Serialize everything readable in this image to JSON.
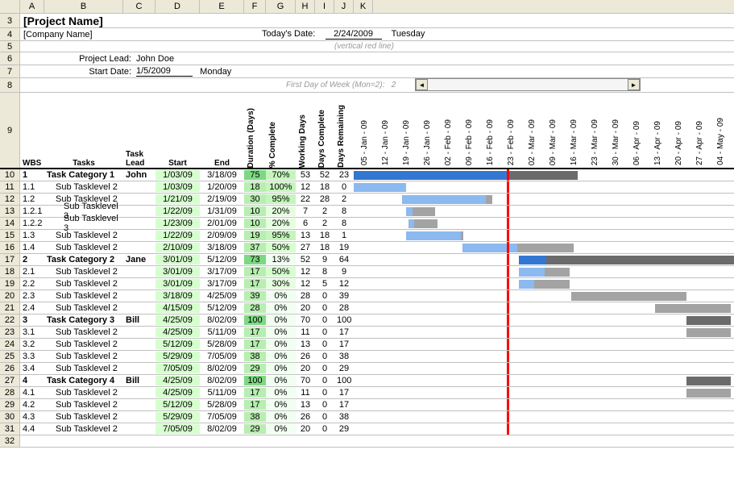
{
  "col_letters": [
    "A",
    "B",
    "C",
    "D",
    "E",
    "F",
    "G",
    "H",
    "I",
    "J",
    "K"
  ],
  "header": {
    "project_name": "[Project Name]",
    "company_name": "[Company Name]",
    "todays_date_label": "Today's Date:",
    "todays_date": "2/24/2009",
    "todays_day": "Tuesday",
    "vertical_note": "(vertical red line)",
    "project_lead_label": "Project Lead:",
    "project_lead": "John Doe",
    "start_date_label": "Start Date:",
    "start_date": "1/5/2009",
    "start_day": "Monday",
    "first_day_label": "First Day of Week (Mon=2):",
    "first_day_value": "2"
  },
  "columns": {
    "wbs": "WBS",
    "tasks": "Tasks",
    "lead": "Task Lead",
    "start": "Start",
    "end": "End",
    "dur": "Duration (Days)",
    "pct": "% Complete",
    "wd": "Working Days",
    "dc": "Days Complete",
    "dr": "Days Remaining"
  },
  "weeks": [
    "05 - Jan - 09",
    "12 - Jan - 09",
    "19 - Jan - 09",
    "26 - Jan - 09",
    "02 - Feb - 09",
    "09 - Feb - 09",
    "16 - Feb - 09",
    "23 - Feb - 09",
    "02 - Mar - 09",
    "09 - Mar - 09",
    "16 - Mar - 09",
    "23 - Mar - 09",
    "30 - Mar - 09",
    "06 - Apr - 09",
    "13 - Apr - 09",
    "20 - Apr - 09",
    "27 - Apr - 09",
    "04 - May - 09"
  ],
  "today_week_offset": 7.3,
  "rows": [
    {
      "n": 10,
      "wbs": "1",
      "task": "Task Category 1",
      "lead": "John",
      "start": "1/03/09",
      "end": "3/18/09",
      "dur": "75",
      "pct": "70%",
      "wd": "53",
      "dc": "52",
      "dr": "23",
      "cat": true,
      "bar": {
        "s": 0,
        "w": 7.3,
        "c": "blue-dark"
      },
      "bar2": {
        "s": 7.3,
        "w": 3.4,
        "c": "gray-dark"
      }
    },
    {
      "n": 11,
      "wbs": "1.1",
      "task": "Sub Tasklevel 2",
      "lead": "",
      "start": "1/03/09",
      "end": "1/20/09",
      "dur": "18",
      "pct": "100%",
      "wd": "12",
      "dc": "18",
      "dr": "0",
      "sub": 1,
      "bar": {
        "s": 0,
        "w": 2.5,
        "c": "blue-light"
      }
    },
    {
      "n": 12,
      "wbs": "1.2",
      "task": "Sub Tasklevel 2",
      "lead": "",
      "start": "1/21/09",
      "end": "2/19/09",
      "dur": "30",
      "pct": "95%",
      "wd": "22",
      "dc": "28",
      "dr": "2",
      "sub": 1,
      "bar": {
        "s": 2.3,
        "w": 4.0,
        "c": "blue-light"
      },
      "bar2": {
        "s": 6.3,
        "w": 0.3,
        "c": "gray-light"
      }
    },
    {
      "n": 13,
      "wbs": "1.2.1",
      "task": "Sub Tasklevel 3",
      "lead": "",
      "start": "1/22/09",
      "end": "1/31/09",
      "dur": "10",
      "pct": "20%",
      "wd": "7",
      "dc": "2",
      "dr": "8",
      "sub": 2,
      "bar": {
        "s": 2.5,
        "w": 0.3,
        "c": "blue-light"
      },
      "bar2": {
        "s": 2.8,
        "w": 1.1,
        "c": "gray-light"
      }
    },
    {
      "n": 14,
      "wbs": "1.2.2",
      "task": "Sub Tasklevel 3",
      "lead": "",
      "start": "1/23/09",
      "end": "2/01/09",
      "dur": "10",
      "pct": "20%",
      "wd": "6",
      "dc": "2",
      "dr": "8",
      "sub": 2,
      "bar": {
        "s": 2.6,
        "w": 0.3,
        "c": "blue-light"
      },
      "bar2": {
        "s": 2.9,
        "w": 1.1,
        "c": "gray-light"
      }
    },
    {
      "n": 15,
      "wbs": "1.3",
      "task": "Sub Tasklevel 2",
      "lead": "",
      "start": "1/22/09",
      "end": "2/09/09",
      "dur": "19",
      "pct": "95%",
      "wd": "13",
      "dc": "18",
      "dr": "1",
      "sub": 1,
      "bar": {
        "s": 2.5,
        "w": 2.6,
        "c": "blue-light"
      },
      "bar2": {
        "s": 5.1,
        "w": 0.15,
        "c": "gray-light"
      }
    },
    {
      "n": 16,
      "wbs": "1.4",
      "task": "Sub Tasklevel 2",
      "lead": "",
      "start": "2/10/09",
      "end": "3/18/09",
      "dur": "37",
      "pct": "50%",
      "wd": "27",
      "dc": "18",
      "dr": "19",
      "sub": 1,
      "bar": {
        "s": 5.2,
        "w": 2.6,
        "c": "blue-light"
      },
      "bar2": {
        "s": 7.8,
        "w": 2.7,
        "c": "gray-light"
      }
    },
    {
      "n": 17,
      "wbs": "2",
      "task": "Task Category 2",
      "lead": "Jane",
      "start": "3/01/09",
      "end": "5/12/09",
      "dur": "73",
      "pct": "13%",
      "wd": "52",
      "dc": "9",
      "dr": "64",
      "cat": true,
      "bar": {
        "s": 7.9,
        "w": 1.3,
        "c": "blue-dark"
      },
      "bar2": {
        "s": 9.2,
        "w": 9.0,
        "c": "gray-dark"
      }
    },
    {
      "n": 18,
      "wbs": "2.1",
      "task": "Sub Tasklevel 2",
      "lead": "",
      "start": "3/01/09",
      "end": "3/17/09",
      "dur": "17",
      "pct": "50%",
      "wd": "12",
      "dc": "8",
      "dr": "9",
      "sub": 1,
      "bar": {
        "s": 7.9,
        "w": 1.2,
        "c": "blue-light"
      },
      "bar2": {
        "s": 9.1,
        "w": 1.2,
        "c": "gray-light"
      }
    },
    {
      "n": 19,
      "wbs": "2.2",
      "task": "Sub Tasklevel 2",
      "lead": "",
      "start": "3/01/09",
      "end": "3/17/09",
      "dur": "17",
      "pct": "30%",
      "wd": "12",
      "dc": "5",
      "dr": "12",
      "sub": 1,
      "bar": {
        "s": 7.9,
        "w": 0.7,
        "c": "blue-light"
      },
      "bar2": {
        "s": 8.6,
        "w": 1.7,
        "c": "gray-light"
      }
    },
    {
      "n": 20,
      "wbs": "2.3",
      "task": "Sub Tasklevel 2",
      "lead": "",
      "start": "3/18/09",
      "end": "4/25/09",
      "dur": "39",
      "pct": "0%",
      "wd": "28",
      "dc": "0",
      "dr": "39",
      "sub": 1,
      "bar2": {
        "s": 10.4,
        "w": 5.5,
        "c": "gray-light"
      }
    },
    {
      "n": 21,
      "wbs": "2.4",
      "task": "Sub Tasklevel 2",
      "lead": "",
      "start": "4/15/09",
      "end": "5/12/09",
      "dur": "28",
      "pct": "0%",
      "wd": "20",
      "dc": "0",
      "dr": "28",
      "sub": 1,
      "bar2": {
        "s": 14.4,
        "w": 3.6,
        "c": "gray-light"
      }
    },
    {
      "n": 22,
      "wbs": "3",
      "task": "Task Category 3",
      "lead": "Bill",
      "start": "4/25/09",
      "end": "8/02/09",
      "dur": "100",
      "pct": "0%",
      "wd": "70",
      "dc": "0",
      "dr": "100",
      "cat": true,
      "bar2": {
        "s": 15.9,
        "w": 2.1,
        "c": "gray-dark"
      }
    },
    {
      "n": 23,
      "wbs": "3.1",
      "task": "Sub Tasklevel 2",
      "lead": "",
      "start": "4/25/09",
      "end": "5/11/09",
      "dur": "17",
      "pct": "0%",
      "wd": "11",
      "dc": "0",
      "dr": "17",
      "sub": 1,
      "bar2": {
        "s": 15.9,
        "w": 2.1,
        "c": "gray-light"
      }
    },
    {
      "n": 24,
      "wbs": "3.2",
      "task": "Sub Tasklevel 2",
      "lead": "",
      "start": "5/12/09",
      "end": "5/28/09",
      "dur": "17",
      "pct": "0%",
      "wd": "13",
      "dc": "0",
      "dr": "17",
      "sub": 1
    },
    {
      "n": 25,
      "wbs": "3.3",
      "task": "Sub Tasklevel 2",
      "lead": "",
      "start": "5/29/09",
      "end": "7/05/09",
      "dur": "38",
      "pct": "0%",
      "wd": "26",
      "dc": "0",
      "dr": "38",
      "sub": 1
    },
    {
      "n": 26,
      "wbs": "3.4",
      "task": "Sub Tasklevel 2",
      "lead": "",
      "start": "7/05/09",
      "end": "8/02/09",
      "dur": "29",
      "pct": "0%",
      "wd": "20",
      "dc": "0",
      "dr": "29",
      "sub": 1
    },
    {
      "n": 27,
      "wbs": "4",
      "task": "Task Category 4",
      "lead": "Bill",
      "start": "4/25/09",
      "end": "8/02/09",
      "dur": "100",
      "pct": "0%",
      "wd": "70",
      "dc": "0",
      "dr": "100",
      "cat": true,
      "bar2": {
        "s": 15.9,
        "w": 2.1,
        "c": "gray-dark"
      }
    },
    {
      "n": 28,
      "wbs": "4.1",
      "task": "Sub Tasklevel 2",
      "lead": "",
      "start": "4/25/09",
      "end": "5/11/09",
      "dur": "17",
      "pct": "0%",
      "wd": "11",
      "dc": "0",
      "dr": "17",
      "sub": 1,
      "bar2": {
        "s": 15.9,
        "w": 2.1,
        "c": "gray-light"
      }
    },
    {
      "n": 29,
      "wbs": "4.2",
      "task": "Sub Tasklevel 2",
      "lead": "",
      "start": "5/12/09",
      "end": "5/28/09",
      "dur": "17",
      "pct": "0%",
      "wd": "13",
      "dc": "0",
      "dr": "17",
      "sub": 1
    },
    {
      "n": 30,
      "wbs": "4.3",
      "task": "Sub Tasklevel 2",
      "lead": "",
      "start": "5/29/09",
      "end": "7/05/09",
      "dur": "38",
      "pct": "0%",
      "wd": "26",
      "dc": "0",
      "dr": "38",
      "sub": 1
    },
    {
      "n": 31,
      "wbs": "4.4",
      "task": "Sub Tasklevel 2",
      "lead": "",
      "start": "7/05/09",
      "end": "8/02/09",
      "dur": "29",
      "pct": "0%",
      "wd": "20",
      "dc": "0",
      "dr": "29",
      "sub": 1
    }
  ],
  "chart_data": {
    "type": "gantt",
    "title": "[Project Name]",
    "x_axis_weeks": [
      "2009-01-05",
      "2009-01-12",
      "2009-01-19",
      "2009-01-26",
      "2009-02-02",
      "2009-02-09",
      "2009-02-16",
      "2009-02-23",
      "2009-03-02",
      "2009-03-09",
      "2009-03-16",
      "2009-03-23",
      "2009-03-30",
      "2009-04-06",
      "2009-04-13",
      "2009-04-20",
      "2009-04-27",
      "2009-05-04"
    ],
    "today": "2009-02-24",
    "tasks": [
      {
        "wbs": "1",
        "name": "Task Category 1",
        "lead": "John",
        "start": "2009-01-03",
        "end": "2009-03-18",
        "duration": 75,
        "pct_complete": 70,
        "working_days": 53,
        "days_complete": 52,
        "days_remaining": 23
      },
      {
        "wbs": "1.1",
        "name": "Sub Tasklevel 2",
        "start": "2009-01-03",
        "end": "2009-01-20",
        "duration": 18,
        "pct_complete": 100,
        "working_days": 12,
        "days_complete": 18,
        "days_remaining": 0
      },
      {
        "wbs": "1.2",
        "name": "Sub Tasklevel 2",
        "start": "2009-01-21",
        "end": "2009-02-19",
        "duration": 30,
        "pct_complete": 95,
        "working_days": 22,
        "days_complete": 28,
        "days_remaining": 2
      },
      {
        "wbs": "1.2.1",
        "name": "Sub Tasklevel 3",
        "start": "2009-01-22",
        "end": "2009-01-31",
        "duration": 10,
        "pct_complete": 20,
        "working_days": 7,
        "days_complete": 2,
        "days_remaining": 8
      },
      {
        "wbs": "1.2.2",
        "name": "Sub Tasklevel 3",
        "start": "2009-01-23",
        "end": "2009-02-01",
        "duration": 10,
        "pct_complete": 20,
        "working_days": 6,
        "days_complete": 2,
        "days_remaining": 8
      },
      {
        "wbs": "1.3",
        "name": "Sub Tasklevel 2",
        "start": "2009-01-22",
        "end": "2009-02-09",
        "duration": 19,
        "pct_complete": 95,
        "working_days": 13,
        "days_complete": 18,
        "days_remaining": 1
      },
      {
        "wbs": "1.4",
        "name": "Sub Tasklevel 2",
        "start": "2009-02-10",
        "end": "2009-03-18",
        "duration": 37,
        "pct_complete": 50,
        "working_days": 27,
        "days_complete": 18,
        "days_remaining": 19
      },
      {
        "wbs": "2",
        "name": "Task Category 2",
        "lead": "Jane",
        "start": "2009-03-01",
        "end": "2009-05-12",
        "duration": 73,
        "pct_complete": 13,
        "working_days": 52,
        "days_complete": 9,
        "days_remaining": 64
      },
      {
        "wbs": "2.1",
        "name": "Sub Tasklevel 2",
        "start": "2009-03-01",
        "end": "2009-03-17",
        "duration": 17,
        "pct_complete": 50,
        "working_days": 12,
        "days_complete": 8,
        "days_remaining": 9
      },
      {
        "wbs": "2.2",
        "name": "Sub Tasklevel 2",
        "start": "2009-03-01",
        "end": "2009-03-17",
        "duration": 17,
        "pct_complete": 30,
        "working_days": 12,
        "days_complete": 5,
        "days_remaining": 12
      },
      {
        "wbs": "2.3",
        "name": "Sub Tasklevel 2",
        "start": "2009-03-18",
        "end": "2009-04-25",
        "duration": 39,
        "pct_complete": 0,
        "working_days": 28,
        "days_complete": 0,
        "days_remaining": 39
      },
      {
        "wbs": "2.4",
        "name": "Sub Tasklevel 2",
        "start": "2009-04-15",
        "end": "2009-05-12",
        "duration": 28,
        "pct_complete": 0,
        "working_days": 20,
        "days_complete": 0,
        "days_remaining": 28
      },
      {
        "wbs": "3",
        "name": "Task Category 3",
        "lead": "Bill",
        "start": "2009-04-25",
        "end": "2009-08-02",
        "duration": 100,
        "pct_complete": 0,
        "working_days": 70,
        "days_complete": 0,
        "days_remaining": 100
      },
      {
        "wbs": "3.1",
        "name": "Sub Tasklevel 2",
        "start": "2009-04-25",
        "end": "2009-05-11",
        "duration": 17,
        "pct_complete": 0,
        "working_days": 11,
        "days_complete": 0,
        "days_remaining": 17
      },
      {
        "wbs": "3.2",
        "name": "Sub Tasklevel 2",
        "start": "2009-05-12",
        "end": "2009-05-28",
        "duration": 17,
        "pct_complete": 0,
        "working_days": 13,
        "days_complete": 0,
        "days_remaining": 17
      },
      {
        "wbs": "3.3",
        "name": "Sub Tasklevel 2",
        "start": "2009-05-29",
        "end": "2009-07-05",
        "duration": 38,
        "pct_complete": 0,
        "working_days": 26,
        "days_complete": 0,
        "days_remaining": 38
      },
      {
        "wbs": "3.4",
        "name": "Sub Tasklevel 2",
        "start": "2009-07-05",
        "end": "2009-08-02",
        "duration": 29,
        "pct_complete": 0,
        "working_days": 20,
        "days_complete": 0,
        "days_remaining": 29
      },
      {
        "wbs": "4",
        "name": "Task Category 4",
        "lead": "Bill",
        "start": "2009-04-25",
        "end": "2009-08-02",
        "duration": 100,
        "pct_complete": 0,
        "working_days": 70,
        "days_complete": 0,
        "days_remaining": 100
      },
      {
        "wbs": "4.1",
        "name": "Sub Tasklevel 2",
        "start": "2009-04-25",
        "end": "2009-05-11",
        "duration": 17,
        "pct_complete": 0,
        "working_days": 11,
        "days_complete": 0,
        "days_remaining": 17
      },
      {
        "wbs": "4.2",
        "name": "Sub Tasklevel 2",
        "start": "2009-05-12",
        "end": "2009-05-28",
        "duration": 17,
        "pct_complete": 0,
        "working_days": 13,
        "days_complete": 0,
        "days_remaining": 17
      },
      {
        "wbs": "4.3",
        "name": "Sub Tasklevel 2",
        "start": "2009-05-29",
        "end": "2009-07-05",
        "duration": 38,
        "pct_complete": 0,
        "working_days": 26,
        "days_complete": 0,
        "days_remaining": 38
      },
      {
        "wbs": "4.4",
        "name": "Sub Tasklevel 2",
        "start": "2009-07-05",
        "end": "2009-08-02",
        "duration": 29,
        "pct_complete": 0,
        "working_days": 20,
        "days_complete": 0,
        "days_remaining": 29
      }
    ]
  }
}
